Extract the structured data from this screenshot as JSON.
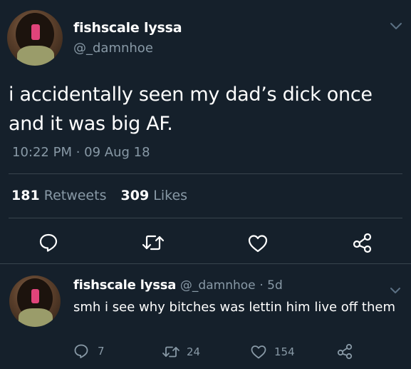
{
  "main_tweet": {
    "display_name": "fishscale lyssa",
    "handle": "@_damnhoe",
    "text_line1": "i accidentally seen my dad’s dick once",
    "text_line2": "and it was big AF.",
    "timestamp": "10:22 PM · 09 Aug 18",
    "retweets_count": "181",
    "retweets_label": "Retweets",
    "likes_count": "309",
    "likes_label": "Likes",
    "actions": [
      "reply-icon",
      "retweet-icon",
      "like-icon",
      "share-icon"
    ]
  },
  "reply_tweet": {
    "display_name": "fishscale lyssa",
    "handle": "@_damnhoe",
    "time_ago": "· 5d",
    "text": "smh i see why bitches was lettin him live off them",
    "reply_count": "7",
    "retweet_count": "24",
    "like_count": "154"
  },
  "colors": {
    "background": "#15202b",
    "secondary_text": "#8899a6",
    "divider": "#38444d"
  }
}
